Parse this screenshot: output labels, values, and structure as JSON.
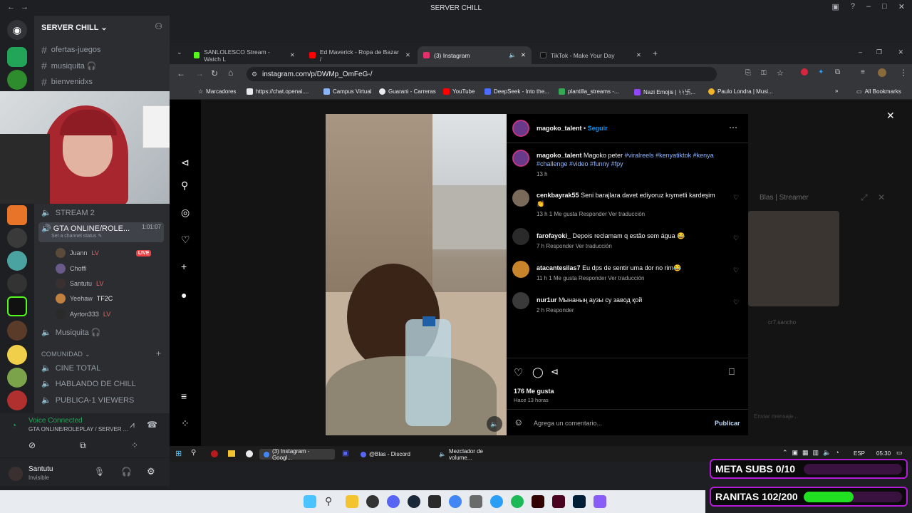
{
  "window": {
    "title": "SERVER CHILL"
  },
  "discord": {
    "server_name": "SERVER CHILL",
    "top_channels": [
      "ofertas-juegos",
      "musiquita 🎧",
      "bienvenidxs"
    ],
    "voice_channels": {
      "stream2": "STREAM 2",
      "gta": {
        "name": "GTA ONLINE/ROLE...",
        "time": "1:01:07",
        "status": "Set a channel status ✎"
      },
      "users": [
        {
          "name": "Juann",
          "badge": "LV",
          "live": "LIVE"
        },
        {
          "name": "Choffi",
          "badge": "",
          "live": ""
        },
        {
          "name": "Santutu",
          "badge": "LV",
          "live": ""
        },
        {
          "name": "Yeehaw",
          "badge": "TF2C",
          "live": ""
        },
        {
          "name": "Ayrton333",
          "badge": "LV",
          "live": ""
        }
      ],
      "musiquita": "Musiquita 🎧"
    },
    "category": "COMUNIDAD",
    "community_channels": [
      "CINE TOTAL",
      "HABLANDO DE CHILL",
      "PUBLICA-1 VIEWERS"
    ],
    "voice_status": {
      "title": "Voice Connected",
      "channel": "GTA ONLINE/ROLEPLAY / SERVER ..."
    },
    "user": {
      "name": "Santutu",
      "status": "Invisible"
    }
  },
  "browser": {
    "tabs": [
      {
        "label": "SANLOLESCO Stream - Watch L",
        "color": "#53fc18"
      },
      {
        "label": "Ed Maverick - Ropa de Bazar /",
        "color": "#ff0000"
      },
      {
        "label": "(3) Instagram",
        "color": "#e1306c"
      },
      {
        "label": "TikTok - Make Your Day",
        "color": "#111111"
      }
    ],
    "url": "instagram.com/p/DWMp_OmFeG-/",
    "bookmarks": [
      {
        "label": "Marcadores"
      },
      {
        "label": "https://chat.openai...."
      },
      {
        "label": "Campus Virtual"
      },
      {
        "label": "Guarani - Carreras"
      },
      {
        "label": "YouTube"
      },
      {
        "label": "DeepSeek - Into the..."
      },
      {
        "label": "plantilla_streams -..."
      },
      {
        "label": "Nazi Emojis | ᛋᛋ卐..."
      },
      {
        "label": "Paulo Londra | Musi..."
      },
      {
        "label": "All Bookmarks"
      }
    ]
  },
  "post": {
    "account": "magoko_talent",
    "follow": "Seguir",
    "caption_user": "magoko_talent",
    "caption_text": "Magoko peter",
    "caption_tags": "#viralreels #kenyatiktok #kenya #challenge #video #funny #fpy",
    "caption_time": "13 h",
    "comments": [
      {
        "user": "cenkbayrak55",
        "text": "Seni barajlara davet ediyoruz kıymetli kardeşim 👏",
        "meta": "13 h    1 Me gusta    Responder    Ver traducción"
      },
      {
        "user": "farofayoki_",
        "text": "Depois reclamam q estão sem água 😂",
        "meta": "7 h    Responder    Ver traducción"
      },
      {
        "user": "atacantesilas7",
        "text": "Eu dps de sentir uma dor no rim😂",
        "meta": "11 h    1 Me gusta    Responder    Ver traducción"
      },
      {
        "user": "nur1ur",
        "text": "Мынаның аузы су завод қой",
        "meta": "2 h    Responder"
      }
    ],
    "likes": "176 Me gusta",
    "time_ago": "Hace 13 horas",
    "comment_placeholder": "Agrega un comentario...",
    "publish": "Publicar"
  },
  "streamer_window": {
    "title": "Blas | Streamer",
    "user": "cr7.sancho",
    "input": "Enviar mensaje..."
  },
  "win_taskbar": {
    "items": [
      "(3) Instagram - Googl...",
      "@Blas - Discord",
      "Mezclador de volume..."
    ],
    "lang": "ESP",
    "clock": "05:30"
  },
  "overlay": {
    "meta_subs": {
      "label": "META SUBS 0/10",
      "progress": 0.0
    },
    "ranitas": {
      "label": "RANITAS 102/200",
      "progress": 0.51
    }
  }
}
